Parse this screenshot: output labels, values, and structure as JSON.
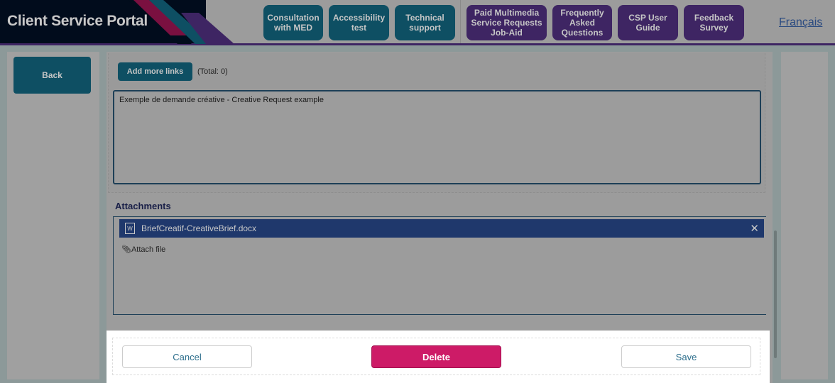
{
  "header": {
    "title": "Client Service Portal",
    "nav": [
      {
        "label": "Consultation with MED"
      },
      {
        "label": "Accessibility test"
      },
      {
        "label": "Technical support"
      },
      {
        "label": "Paid Multimedia Service Requests Job-Aid"
      },
      {
        "label": "Frequently Asked Questions"
      },
      {
        "label": "CSP User Guide"
      },
      {
        "label": "Feedback Survey"
      }
    ],
    "language_link": "Français"
  },
  "sidebar": {
    "back_label": "Back"
  },
  "links": {
    "add_label": "Add more links",
    "total": "(Total: 0)"
  },
  "description": {
    "value": "Exemple de demande créative - Creative Request example"
  },
  "attachments": {
    "label": "Attachments",
    "files": [
      {
        "name": "BriefCreatif-CreativeBrief.docx"
      }
    ],
    "attach_label": "Attach file"
  },
  "footer": {
    "cancel": "Cancel",
    "delete": "Delete",
    "save": "Save"
  },
  "colors": {
    "teal": "#0e4f63",
    "purple": "#3e2563",
    "delete": "#cd1b67",
    "file_row": "#1f386c"
  }
}
